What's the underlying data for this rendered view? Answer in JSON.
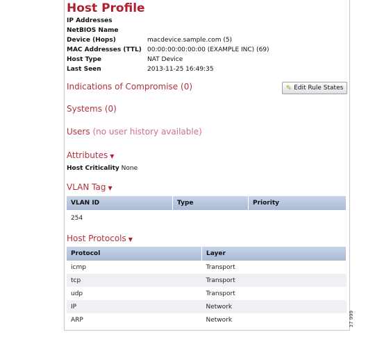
{
  "title": "Host Profile",
  "info": {
    "ip_label": "IP Addresses",
    "netbios_label": "NetBIOS Name",
    "device_label": "Device (Hops)",
    "device_value": "macdevice.sample.com (5)",
    "mac_label": "MAC Addresses (TTL)",
    "mac_value": "00:00:00:00:00:00 (EXAMPLE INC) (69)",
    "host_type_label": "Host Type",
    "host_type_value": "NAT Device",
    "last_seen_label": "Last Seen",
    "last_seen_value": "2013-11-25 16:49:35"
  },
  "ioc": {
    "label": "Indications of Compromise",
    "count": "(0)",
    "button": "Edit Rule States"
  },
  "systems": {
    "label": "Systems",
    "count": "(0)"
  },
  "users": {
    "label": "Users",
    "note": "(no user history available)"
  },
  "attributes": {
    "label": "Attributes",
    "crit_label": "Host Criticality",
    "crit_value": "None"
  },
  "vlan": {
    "label": "VLAN Tag",
    "headers": [
      "VLAN ID",
      "Type",
      "Priority"
    ],
    "rows": [
      [
        "254",
        "",
        ""
      ]
    ]
  },
  "protocols": {
    "label": "Host Protocols",
    "headers": [
      "Protocol",
      "Layer"
    ],
    "rows": [
      [
        "icmp",
        "Transport"
      ],
      [
        "tcp",
        "Transport"
      ],
      [
        "udp",
        "Transport"
      ],
      [
        "IP",
        "Network"
      ],
      [
        "ARP",
        "Network"
      ]
    ]
  },
  "figure_number": "37 999",
  "icons": {
    "dropdown": "triangle-down-icon",
    "edit": "pencil-icon"
  }
}
